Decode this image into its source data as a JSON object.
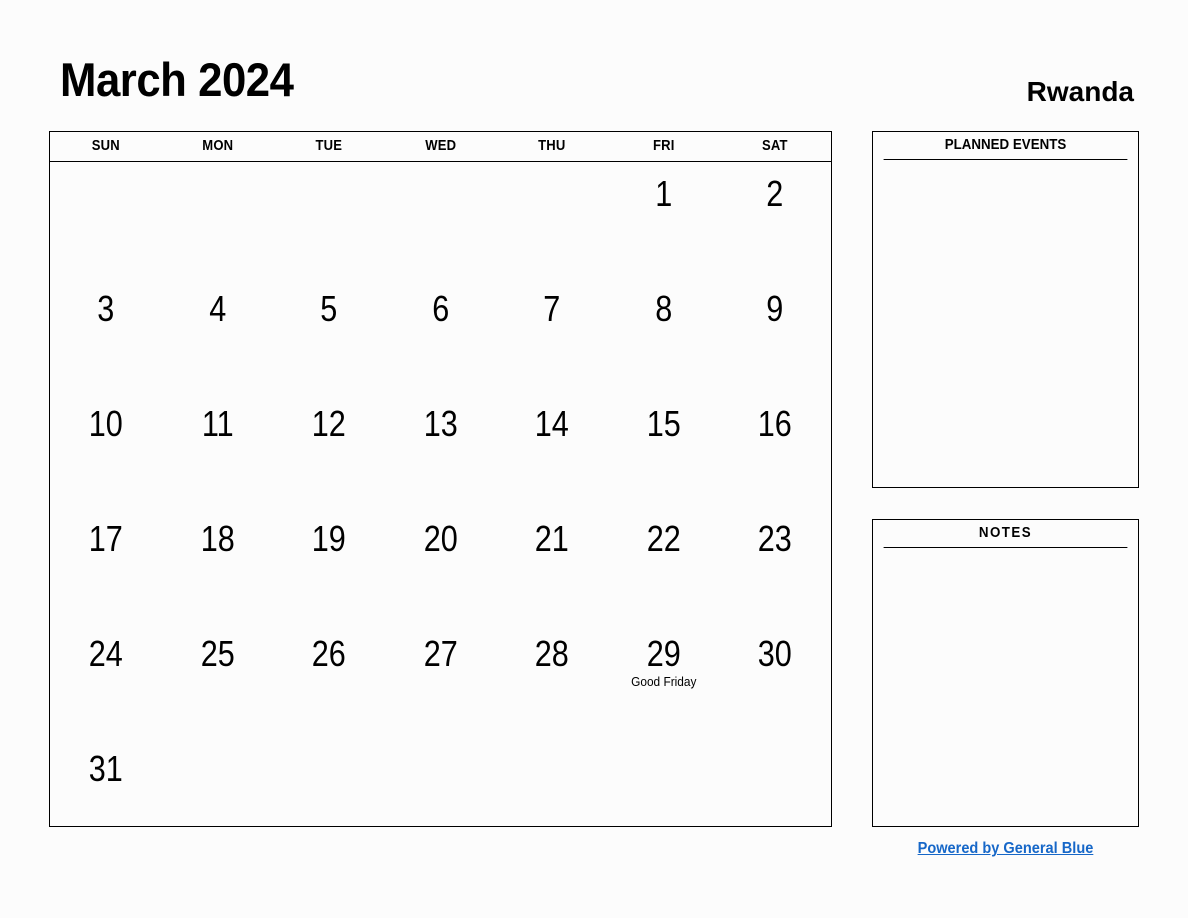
{
  "header": {
    "title": "March 2024",
    "country": "Rwanda"
  },
  "calendar": {
    "weekdays": [
      "SUN",
      "MON",
      "TUE",
      "WED",
      "THU",
      "FRI",
      "SAT"
    ],
    "weeks": [
      [
        {
          "day": ""
        },
        {
          "day": ""
        },
        {
          "day": ""
        },
        {
          "day": ""
        },
        {
          "day": ""
        },
        {
          "day": "1"
        },
        {
          "day": "2"
        }
      ],
      [
        {
          "day": "3"
        },
        {
          "day": "4"
        },
        {
          "day": "5"
        },
        {
          "day": "6"
        },
        {
          "day": "7"
        },
        {
          "day": "8"
        },
        {
          "day": "9"
        }
      ],
      [
        {
          "day": "10"
        },
        {
          "day": "11"
        },
        {
          "day": "12"
        },
        {
          "day": "13"
        },
        {
          "day": "14"
        },
        {
          "day": "15"
        },
        {
          "day": "16"
        }
      ],
      [
        {
          "day": "17"
        },
        {
          "day": "18"
        },
        {
          "day": "19"
        },
        {
          "day": "20"
        },
        {
          "day": "21"
        },
        {
          "day": "22"
        },
        {
          "day": "23"
        }
      ],
      [
        {
          "day": "24"
        },
        {
          "day": "25"
        },
        {
          "day": "26"
        },
        {
          "day": "27"
        },
        {
          "day": "28"
        },
        {
          "day": "29",
          "event": "Good Friday"
        },
        {
          "day": "30"
        }
      ],
      [
        {
          "day": "31"
        },
        {
          "day": ""
        },
        {
          "day": ""
        },
        {
          "day": ""
        },
        {
          "day": ""
        },
        {
          "day": ""
        },
        {
          "day": ""
        }
      ]
    ]
  },
  "panels": {
    "planned_events": {
      "title": "PLANNED EVENTS"
    },
    "notes": {
      "title": "NOTES"
    }
  },
  "footer": {
    "link_text": "Powered by General Blue",
    "link_color": "#1667c8"
  }
}
